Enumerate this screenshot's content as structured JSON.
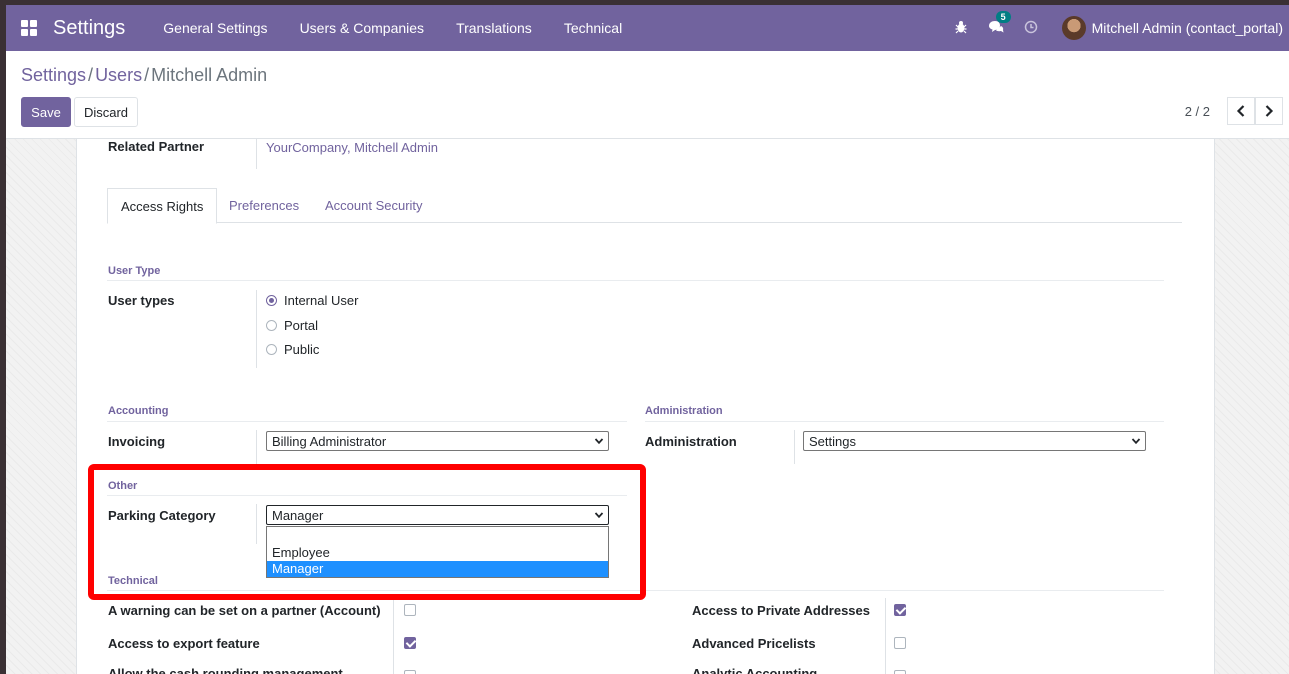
{
  "navbar": {
    "brand": "Settings",
    "menu": [
      "General Settings",
      "Users & Companies",
      "Translations",
      "Technical"
    ],
    "chat_badge": "5",
    "user": "Mitchell Admin (contact_portal)",
    "icons": [
      "bug-icon",
      "chat-icon",
      "clock-icon"
    ]
  },
  "breadcrumb": {
    "items": [
      "Settings",
      "Users"
    ],
    "active": "Mitchell Admin",
    "separator": "/"
  },
  "actions": {
    "save": "Save",
    "discard": "Discard"
  },
  "pager": {
    "value": "2 / 2"
  },
  "form": {
    "related_partner_label": "Related Partner",
    "related_partner_value": "YourCompany, Mitchell Admin",
    "tabs": [
      "Access Rights",
      "Preferences",
      "Account Security"
    ],
    "user_type": {
      "section": "User Type",
      "label": "User types",
      "options": [
        "Internal User",
        "Portal",
        "Public"
      ],
      "selected": "Internal User"
    },
    "accounting": {
      "section": "Accounting",
      "label": "Invoicing",
      "value": "Billing Administrator"
    },
    "administration": {
      "section": "Administration",
      "label": "Administration",
      "value": "Settings"
    },
    "other": {
      "section": "Other",
      "label": "Parking Category",
      "value": "Manager",
      "options": [
        "",
        "Employee",
        "Manager"
      ],
      "highlighted": "Manager"
    },
    "technical": {
      "section": "Technical",
      "rows": [
        {
          "label": "A warning can be set on a partner (Account)",
          "checked": false
        },
        {
          "label": "Access to export feature",
          "checked": true
        },
        {
          "label": "Allow the cash rounding management",
          "checked": false
        }
      ],
      "rows_right": [
        {
          "label": "Access to Private Addresses",
          "checked": true
        },
        {
          "label": "Advanced Pricelists",
          "checked": false
        },
        {
          "label": "Analytic Accounting",
          "checked": false
        }
      ]
    }
  },
  "colors": {
    "brand": "#71639e",
    "highlight": "#1e90ff",
    "annotation": "#ff0000"
  }
}
